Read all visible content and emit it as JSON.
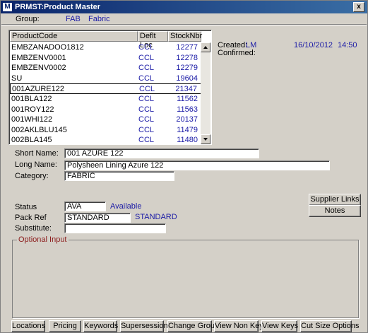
{
  "window": {
    "title": "PRMST:Product Master",
    "app_icon": "M",
    "close": "x"
  },
  "group": {
    "label": "Group:",
    "code": "FAB",
    "name": "Fabric"
  },
  "list": {
    "headers": [
      "ProductCode",
      "Deflt Loc",
      "StockNbr"
    ],
    "rows": [
      [
        "EMBZANADOO1812",
        "CCL",
        "12277"
      ],
      [
        "EMBZENV0001",
        "CCL",
        "12278"
      ],
      [
        "EMBZENV0002",
        "CCL",
        "12279"
      ],
      [
        "SU",
        "CCL",
        "19604"
      ],
      [
        "001AZURE122",
        "CCL",
        "21347"
      ],
      [
        "001BLA122",
        "CCL",
        "11562"
      ],
      [
        "001ROY122",
        "CCL",
        "11563"
      ],
      [
        "001WHI122",
        "CCL",
        "20137"
      ],
      [
        "002AKLBLU145",
        "CCL",
        "11479"
      ],
      [
        "002BLA145",
        "CCL",
        "11480"
      ]
    ],
    "selected_index": 4
  },
  "info": {
    "created_label": "Created:",
    "created_by": "LM",
    "created_date": "16/10/2012",
    "created_time": "14:50",
    "confirmed_label": "Confirmed:"
  },
  "form": {
    "short_name_label": "Short Name:",
    "short_name": "001 AZURE 122",
    "long_name_label": "Long Name:",
    "long_name": "Polysheen Lining Azure 122",
    "category_label": "Category:",
    "category": "FABRIC",
    "status_label": "Status",
    "status": "AVA",
    "status_desc": "Available",
    "pack_ref_label": "Pack Ref",
    "pack_ref": "STANDARD",
    "pack_ref_desc": "STANDARD",
    "substitute_label": "Substitute:",
    "substitute": ""
  },
  "side_buttons": {
    "supplier_links": "Supplier Links",
    "notes": "Notes"
  },
  "optional_input_label": "Optional Input",
  "bottom_buttons": [
    "Locations",
    "Pricing",
    "Keywords",
    "Supersession",
    "Change Group",
    "View Non Keys",
    "View Keys",
    "Cut Size Options"
  ]
}
